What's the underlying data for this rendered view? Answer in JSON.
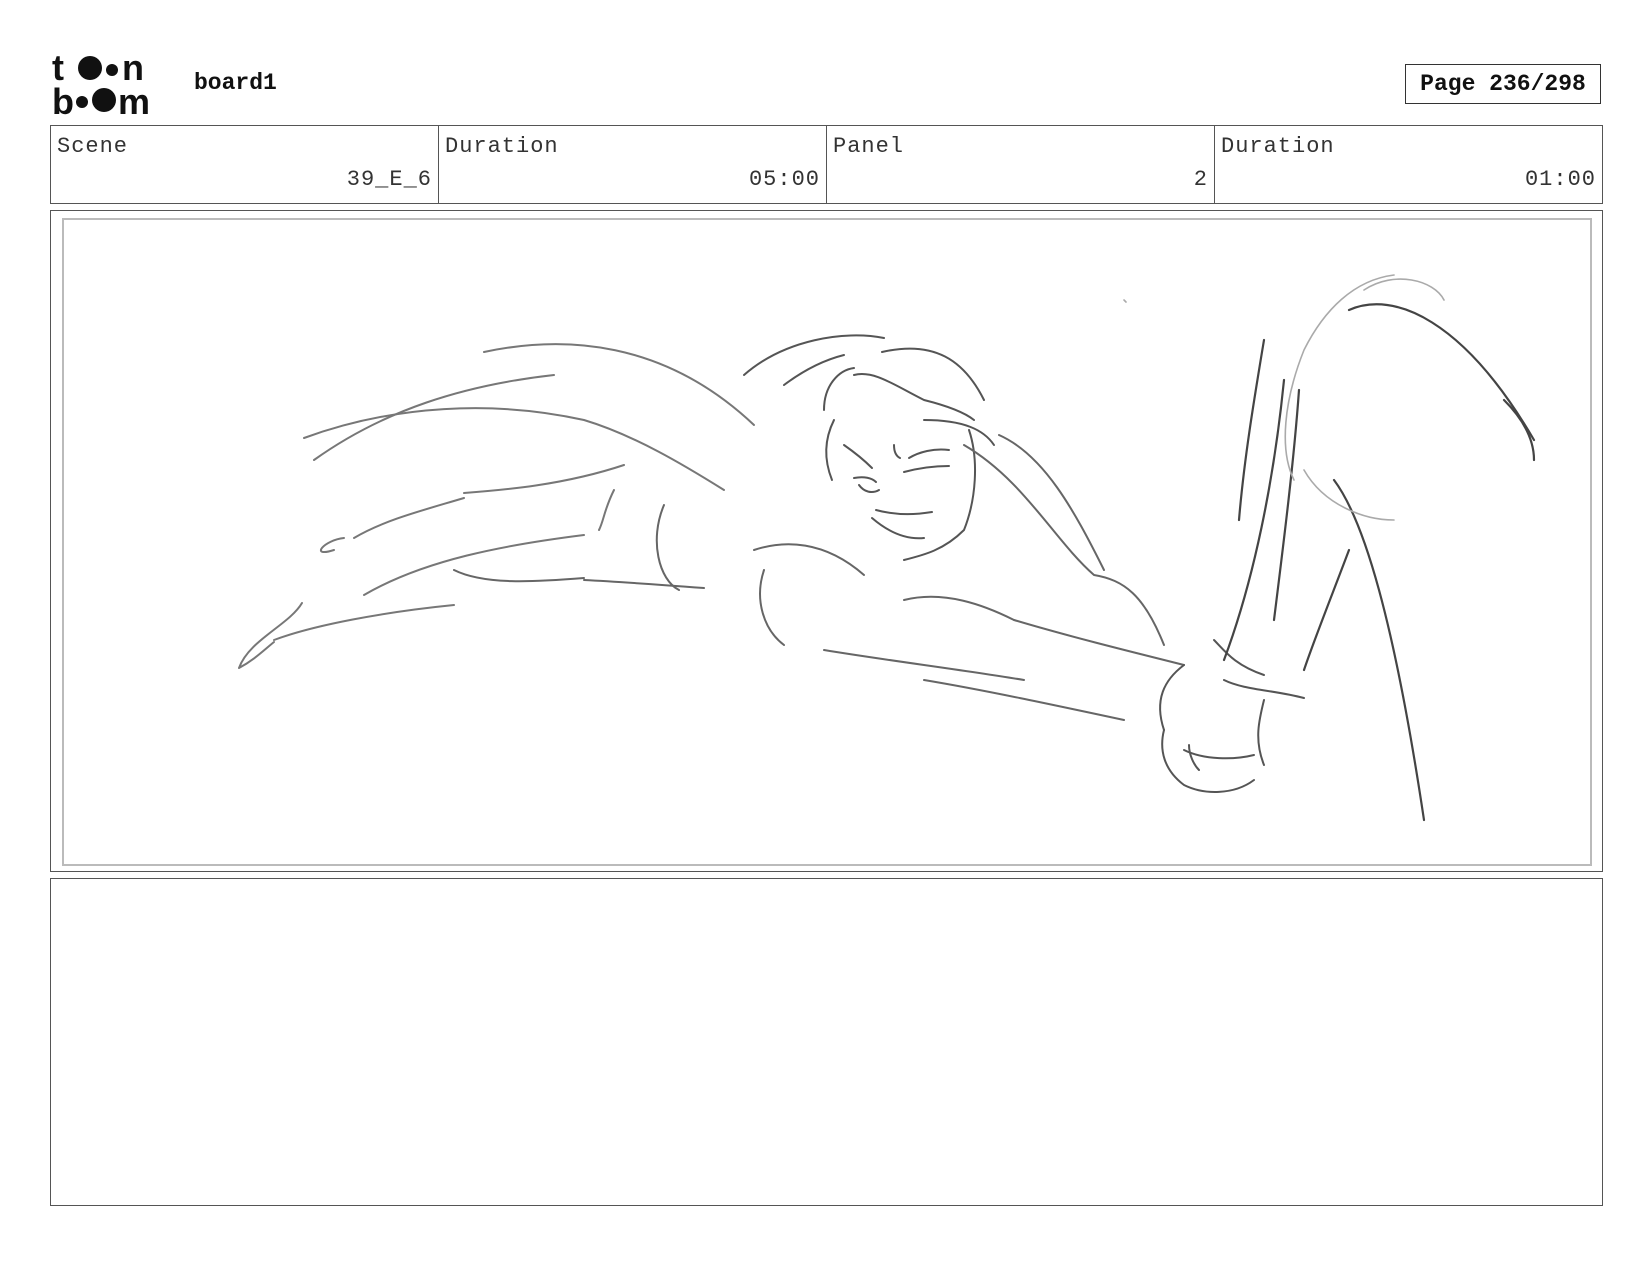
{
  "header": {
    "logo_text": "toon boom",
    "board_title": "board1",
    "page_label": "Page 236/298"
  },
  "info": {
    "scene_label": "Scene",
    "scene_value": "39_E_6",
    "scene_duration_label": "Duration",
    "scene_duration_value": "05:00",
    "panel_label": "Panel",
    "panel_value": "2",
    "panel_duration_label": "Duration",
    "panel_duration_value": "01:00"
  },
  "panel": {
    "image_description": "",
    "notes": ""
  }
}
